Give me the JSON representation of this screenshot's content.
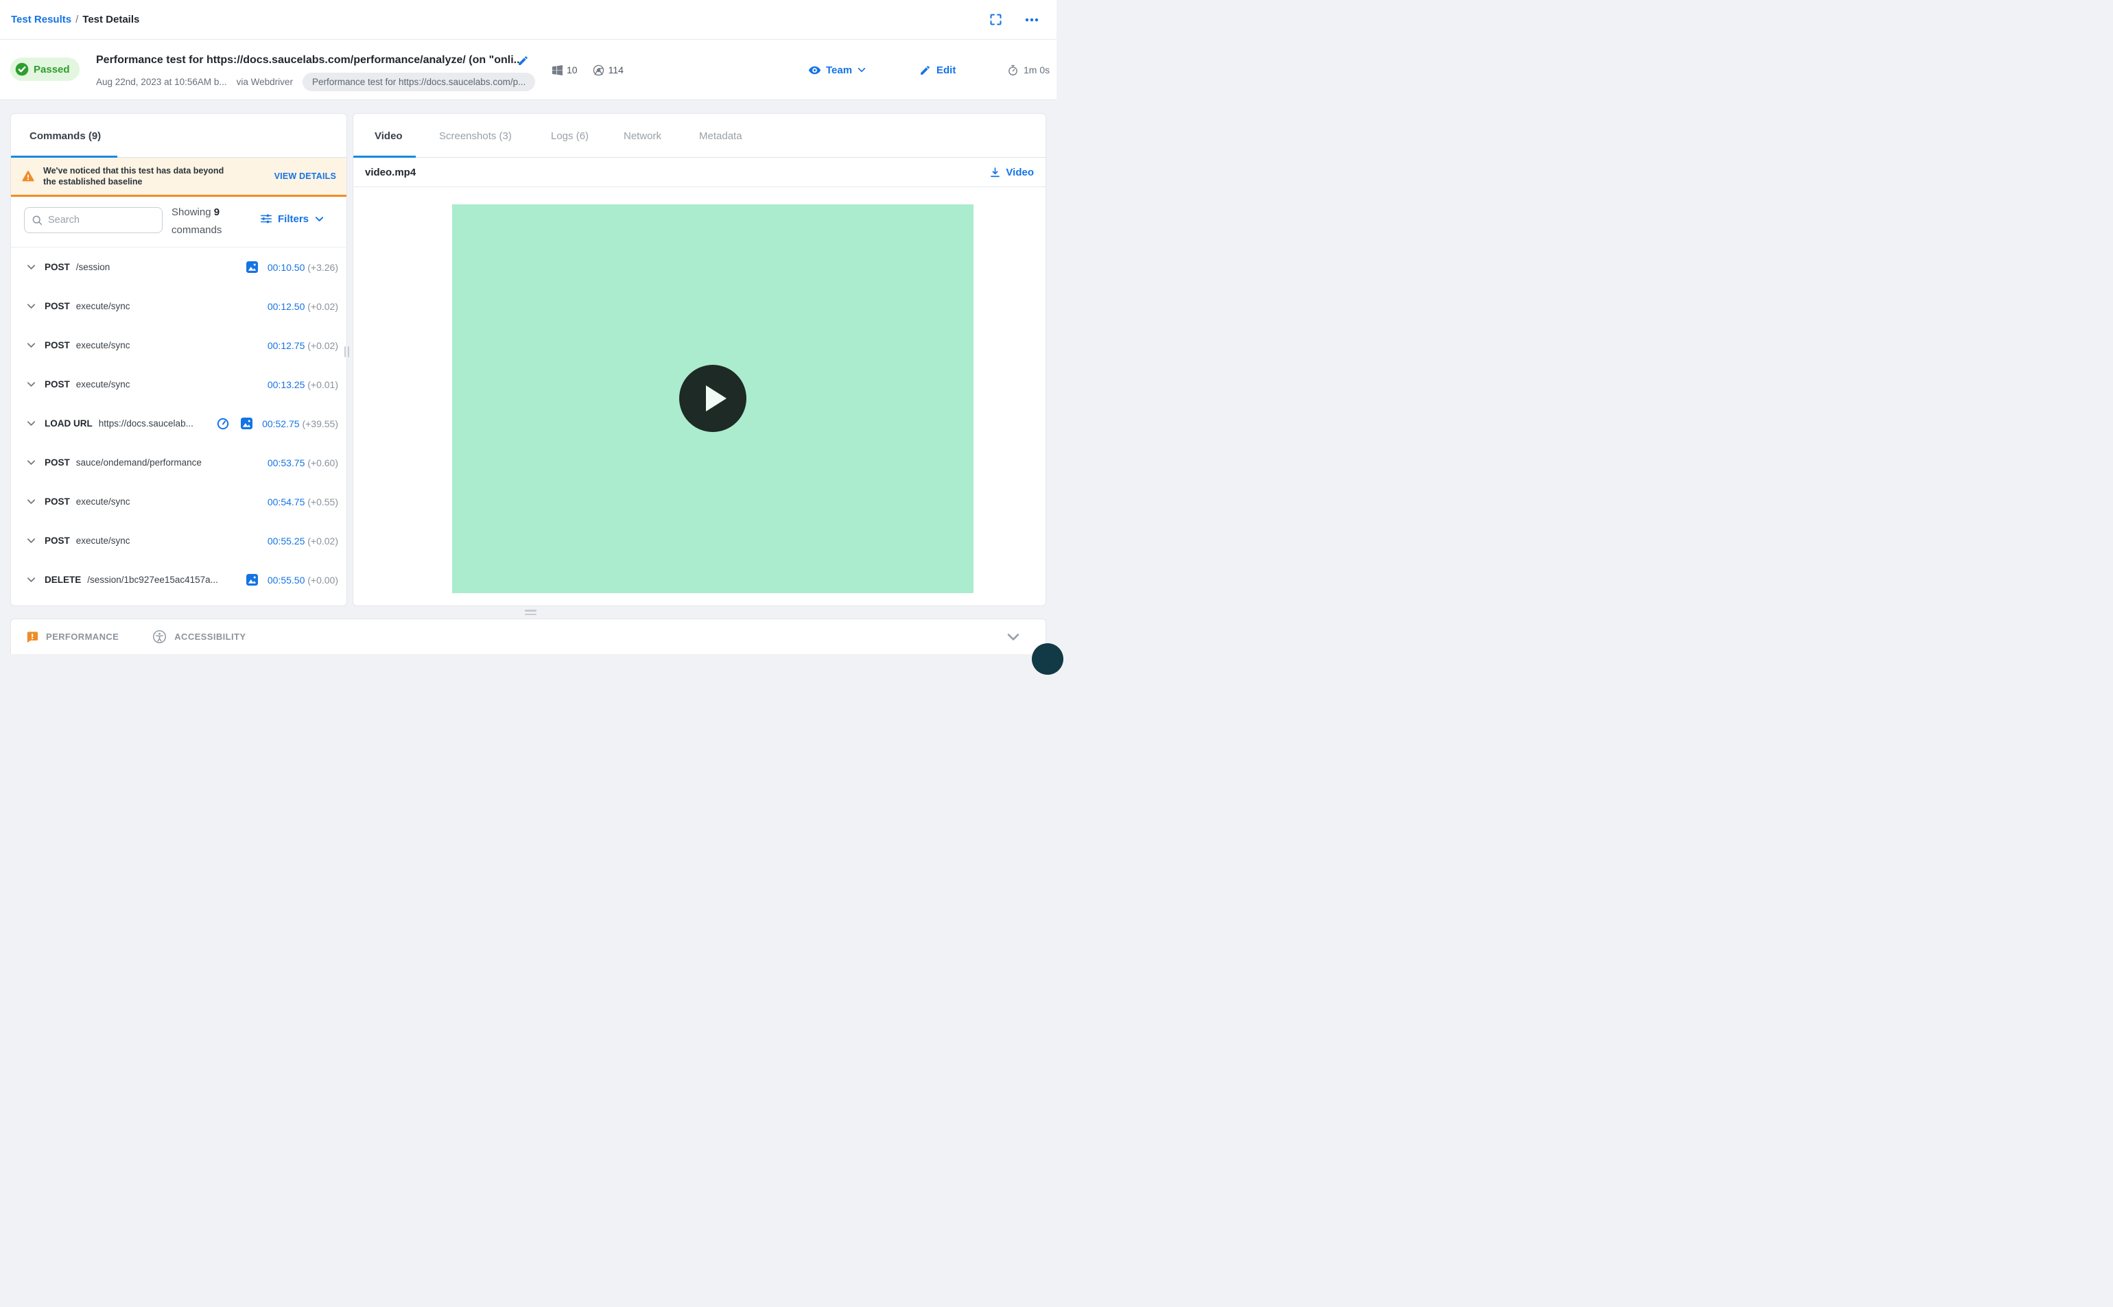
{
  "breadcrumb": {
    "parent": "Test Results",
    "separator": "/",
    "current": "Test Details"
  },
  "header": {
    "status": "Passed",
    "title": "Performance test for https://docs.saucelabs.com/performance/analyze/ (on \"onli...",
    "date": "Aug 22nd, 2023 at 10:56AM b...",
    "via": "via Webdriver",
    "tag": "Performance test for https://docs.saucelabs.com/p...",
    "os_version": "10",
    "browser_version": "114",
    "team_label": "Team",
    "edit_label": "Edit",
    "duration": "1m 0s"
  },
  "commands_panel": {
    "tab_label": "Commands (9)",
    "warning": {
      "text": "We've noticed that this test has data beyond the established baseline",
      "action": "VIEW DETAILS"
    },
    "search_placeholder": "Search",
    "showing_prefix": "Showing",
    "showing_count": "9",
    "showing_suffix": "commands",
    "filters_label": "Filters",
    "rows": [
      {
        "method": "POST",
        "path": "/session",
        "time": "00:10.50",
        "delta": "(+3.26)"
      },
      {
        "method": "POST",
        "path": "execute/sync",
        "time": "00:12.50",
        "delta": "(+0.02)"
      },
      {
        "method": "POST",
        "path": "execute/sync",
        "time": "00:12.75",
        "delta": "(+0.02)"
      },
      {
        "method": "POST",
        "path": "execute/sync",
        "time": "00:13.25",
        "delta": "(+0.01)"
      },
      {
        "method": "LOAD URL",
        "path": "https://docs.saucelab...",
        "time": "00:52.75",
        "delta": "(+39.55)"
      },
      {
        "method": "POST",
        "path": "sauce/ondemand/performance",
        "time": "00:53.75",
        "delta": "(+0.60)"
      },
      {
        "method": "POST",
        "path": "execute/sync",
        "time": "00:54.75",
        "delta": "(+0.55)"
      },
      {
        "method": "POST",
        "path": "execute/sync",
        "time": "00:55.25",
        "delta": "(+0.02)"
      },
      {
        "method": "DELETE",
        "path": "/session/1bc927ee15ac4157a...",
        "time": "00:55.50",
        "delta": "(+0.00)"
      }
    ]
  },
  "media_panel": {
    "tabs": [
      {
        "label": "Video"
      },
      {
        "label": "Screenshots (3)"
      },
      {
        "label": "Logs (6)"
      },
      {
        "label": "Network"
      },
      {
        "label": "Metadata"
      }
    ],
    "file_name": "video.mp4",
    "download_label": "Video"
  },
  "bottom_bar": {
    "performance_label": "PERFORMANCE",
    "accessibility_label": "ACCESSIBILITY"
  },
  "colors": {
    "accent_blue": "#1473e6",
    "passed_green": "#2f9e30",
    "warning_orange": "#f08c28",
    "video_green": "#abebce"
  }
}
